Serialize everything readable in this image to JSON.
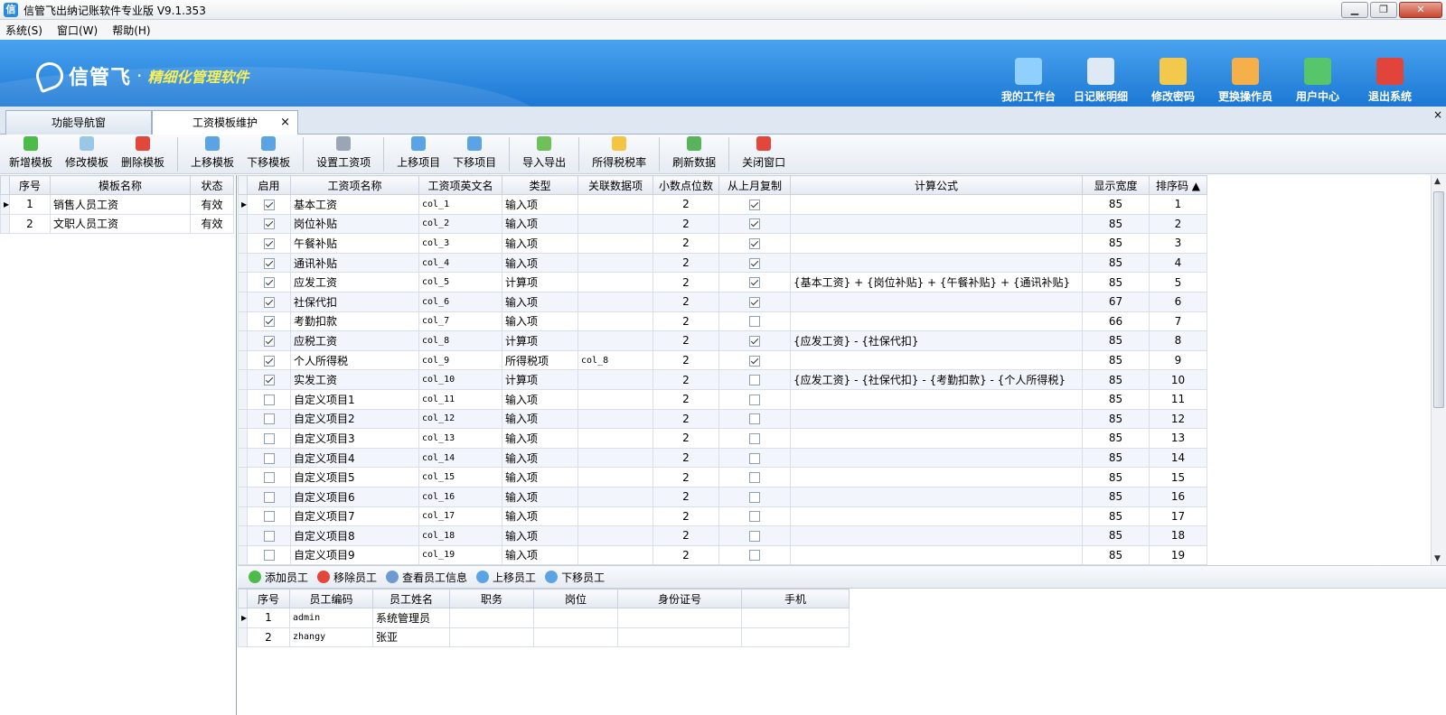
{
  "window": {
    "title": "信管飞出纳记账软件专业版 V9.1.353",
    "min": "▁",
    "restore": "❐",
    "close": "✕"
  },
  "menu": [
    "系统(S)",
    "窗口(W)",
    "帮助(H)"
  ],
  "banner": {
    "brand": "信管飞",
    "dot": "·",
    "slogan": "精细化管理软件",
    "nav": [
      {
        "label": "我的工作台",
        "icon": "monitor-icon",
        "color": "#8fd0ff"
      },
      {
        "label": "日记账明细",
        "icon": "ledger-icon",
        "color": "#dfe8f5"
      },
      {
        "label": "修改密码",
        "icon": "lock-icon",
        "color": "#f2c94c"
      },
      {
        "label": "更换操作员",
        "icon": "user-icon",
        "color": "#f5b04a"
      },
      {
        "label": "用户中心",
        "icon": "globe-icon",
        "color": "#57c56a"
      },
      {
        "label": "退出系统",
        "icon": "power-icon",
        "color": "#e0443a"
      }
    ]
  },
  "tabs": [
    "功能导航窗",
    "工资模板维护"
  ],
  "tabclose": "×",
  "toolbar": [
    {
      "label": "新增模板",
      "icon": "add-icon",
      "color": "#4dbb4a"
    },
    {
      "label": "修改模板",
      "icon": "edit-icon",
      "color": "#9ac7e8"
    },
    {
      "label": "删除模板",
      "icon": "delete-icon",
      "color": "#e2473b"
    },
    {
      "label": "上移模板",
      "icon": "up-icon",
      "color": "#5aa4e6"
    },
    {
      "label": "下移模板",
      "icon": "down-icon",
      "color": "#5aa4e6"
    },
    {
      "label": "设置工资项",
      "icon": "tools-icon",
      "color": "#9aa5b5"
    },
    {
      "label": "上移项目",
      "icon": "up-icon",
      "color": "#5aa4e6"
    },
    {
      "label": "下移项目",
      "icon": "down-icon",
      "color": "#5aa4e6"
    },
    {
      "label": "导入导出",
      "icon": "import-export-icon",
      "color": "#6fbf5b"
    },
    {
      "label": "所得税税率",
      "icon": "star-icon",
      "color": "#f4c542"
    },
    {
      "label": "刷新数据",
      "icon": "refresh-icon",
      "color": "#58b35a"
    },
    {
      "label": "关闭窗口",
      "icon": "close-window-icon",
      "color": "#e2473b"
    }
  ],
  "templates": {
    "headers": [
      "序号",
      "模板名称",
      "状态"
    ],
    "rows": [
      [
        "1",
        "销售人员工资",
        "有效"
      ],
      [
        "2",
        "文职人员工资",
        "有效"
      ]
    ]
  },
  "items": {
    "headers": [
      "启用",
      "工资项名称",
      "工资项英文名",
      "类型",
      "关联数据项",
      "小数点位数",
      "从上月复制",
      "计算公式",
      "显示宽度",
      "排序码 ▲"
    ],
    "rows": [
      [
        true,
        "基本工资",
        "col_1",
        "输入项",
        "",
        "2",
        true,
        "",
        "85",
        "1"
      ],
      [
        true,
        "岗位补贴",
        "col_2",
        "输入项",
        "",
        "2",
        true,
        "",
        "85",
        "2"
      ],
      [
        true,
        "午餐补贴",
        "col_3",
        "输入项",
        "",
        "2",
        true,
        "",
        "85",
        "3"
      ],
      [
        true,
        "通讯补贴",
        "col_4",
        "输入项",
        "",
        "2",
        true,
        "",
        "85",
        "4"
      ],
      [
        true,
        "应发工资",
        "col_5",
        "计算项",
        "",
        "2",
        true,
        "{基本工资} + {岗位补贴} + {午餐补贴} + {通讯补贴}",
        "85",
        "5"
      ],
      [
        true,
        "社保代扣",
        "col_6",
        "输入项",
        "",
        "2",
        true,
        "",
        "67",
        "6"
      ],
      [
        true,
        "考勤扣款",
        "col_7",
        "输入项",
        "",
        "2",
        false,
        "",
        "66",
        "7"
      ],
      [
        true,
        "应税工资",
        "col_8",
        "计算项",
        "",
        "2",
        true,
        "{应发工资} - {社保代扣}",
        "85",
        "8"
      ],
      [
        true,
        "个人所得税",
        "col_9",
        "所得税项",
        "col_8",
        "2",
        true,
        "",
        "85",
        "9"
      ],
      [
        true,
        "实发工资",
        "col_10",
        "计算项",
        "",
        "2",
        false,
        "{应发工资} - {社保代扣} - {考勤扣款} - {个人所得税}",
        "85",
        "10"
      ],
      [
        false,
        "自定义项目1",
        "col_11",
        "输入项",
        "",
        "2",
        false,
        "",
        "85",
        "11"
      ],
      [
        false,
        "自定义项目2",
        "col_12",
        "输入项",
        "",
        "2",
        false,
        "",
        "85",
        "12"
      ],
      [
        false,
        "自定义项目3",
        "col_13",
        "输入项",
        "",
        "2",
        false,
        "",
        "85",
        "13"
      ],
      [
        false,
        "自定义项目4",
        "col_14",
        "输入项",
        "",
        "2",
        false,
        "",
        "85",
        "14"
      ],
      [
        false,
        "自定义项目5",
        "col_15",
        "输入项",
        "",
        "2",
        false,
        "",
        "85",
        "15"
      ],
      [
        false,
        "自定义项目6",
        "col_16",
        "输入项",
        "",
        "2",
        false,
        "",
        "85",
        "16"
      ],
      [
        false,
        "自定义项目7",
        "col_17",
        "输入项",
        "",
        "2",
        false,
        "",
        "85",
        "17"
      ],
      [
        false,
        "自定义项目8",
        "col_18",
        "输入项",
        "",
        "2",
        false,
        "",
        "85",
        "18"
      ],
      [
        false,
        "自定义项目9",
        "col_19",
        "输入项",
        "",
        "2",
        false,
        "",
        "85",
        "19"
      ]
    ]
  },
  "empTool": [
    {
      "label": "添加员工",
      "icon": "add-icon",
      "color": "#4dbb4a"
    },
    {
      "label": "移除员工",
      "icon": "delete-icon",
      "color": "#e2473b"
    },
    {
      "label": "查看员工信息",
      "icon": "card-icon",
      "color": "#6d9ad0"
    },
    {
      "label": "上移员工",
      "icon": "up-icon",
      "color": "#5aa4e6"
    },
    {
      "label": "下移员工",
      "icon": "down-icon",
      "color": "#5aa4e6"
    }
  ],
  "employees": {
    "headers": [
      "序号",
      "员工编码",
      "员工姓名",
      "职务",
      "岗位",
      "身份证号",
      "手机"
    ],
    "rows": [
      [
        "1",
        "admin",
        "系统管理员",
        "",
        "",
        "",
        ""
      ],
      [
        "2",
        "zhangy",
        "张亚",
        "",
        "",
        "",
        ""
      ]
    ]
  },
  "row_pointer": "▸",
  "scroll": {
    "up": "▲",
    "down": "▼"
  }
}
